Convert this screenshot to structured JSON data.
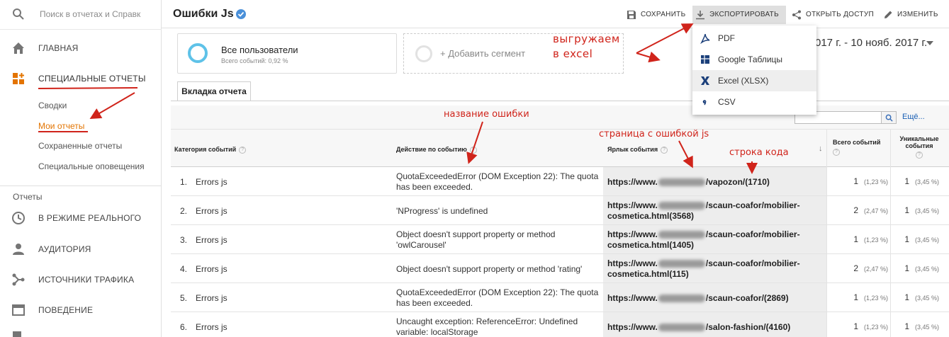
{
  "sidebar": {
    "search_placeholder": "Поиск в отчетах и Справк",
    "home": "ГЛАВНАЯ",
    "custom_reports": "СПЕЦИАЛЬНЫЕ ОТЧЕТЫ",
    "sub": [
      "Сводки",
      "Мои отчеты",
      "Сохраненные отчеты",
      "Специальные оповещения"
    ],
    "reports_section": "Отчеты",
    "items": [
      "В РЕЖИМЕ РЕАЛЬНОГО",
      "АУДИТОРИЯ",
      "ИСТОЧНИКИ ТРАФИКА",
      "ПОВЕДЕНИЕ"
    ]
  },
  "header": {
    "title": "Ошибки Js",
    "save": "СОХРАНИТЬ",
    "export": "ЭКСПОРТИРОВАТЬ",
    "share": "ОТКРЫТЬ ДОСТУП",
    "edit": "ИЗМЕНИТЬ"
  },
  "segments": {
    "all_users": "Все пользователи",
    "all_users_sub": "Всего событий: 0,92 %",
    "add_segment": "+ Добавить сегмент"
  },
  "date_range": "017 г. - 10 нояб. 2017 г.",
  "export_menu": [
    "PDF",
    "Google Таблицы",
    "Excel (XLSX)",
    "CSV"
  ],
  "tab": "Вкладка отчета",
  "more_label": "Ещё...",
  "columns": {
    "category": "Категория событий",
    "action": "Действие по событию",
    "label": "Ярлык события",
    "total": "Всего событий",
    "unique": "Уникальные события"
  },
  "rows": [
    {
      "n": "1.",
      "cat": "Errors js",
      "action": "QuotaExceededError (DOM Exception 22): The quota has been exceeded.",
      "pre": "https://www.",
      "post": "/vapozon/(1710)",
      "total": "1",
      "tpct": "(1,23 %)",
      "uniq": "1",
      "upct": "(3,45 %)"
    },
    {
      "n": "2.",
      "cat": "Errors js",
      "action": "'NProgress' is undefined",
      "pre": "https://www.",
      "post": "/scaun-coafor/mobilier-cosmetica.html(3568)",
      "total": "2",
      "tpct": "(2,47 %)",
      "uniq": "1",
      "upct": "(3,45 %)"
    },
    {
      "n": "3.",
      "cat": "Errors js",
      "action": "Object doesn't support property or method 'owlCarousel'",
      "pre": "https://www.",
      "post": "/scaun-coafor/mobilier-cosmetica.html(1405)",
      "total": "1",
      "tpct": "(1,23 %)",
      "uniq": "1",
      "upct": "(3,45 %)"
    },
    {
      "n": "4.",
      "cat": "Errors js",
      "action": "Object doesn't support property or method 'rating'",
      "pre": "https://www.",
      "post": "/scaun-coafor/mobilier-cosmetica.html(115)",
      "total": "2",
      "tpct": "(2,47 %)",
      "uniq": "1",
      "upct": "(3,45 %)"
    },
    {
      "n": "5.",
      "cat": "Errors js",
      "action": "QuotaExceededError (DOM Exception 22): The quota has been exceeded.",
      "pre": "https://www.",
      "post": "/scaun-coafor/(2869)",
      "total": "1",
      "tpct": "(1,23 %)",
      "uniq": "1",
      "upct": "(3,45 %)"
    },
    {
      "n": "6.",
      "cat": "Errors js",
      "action": "Uncaught exception: ReferenceError: Undefined variable: localStorage",
      "pre": "https://www.",
      "post": "/salon-fashion/(4160)",
      "total": "1",
      "tpct": "(1,23 %)",
      "uniq": "1",
      "upct": "(3,45 %)"
    }
  ],
  "annotations": {
    "excel": "выгружаем\nв excel",
    "error_name": "название ошибки",
    "page": "страница с ошибкой js",
    "code_line": "строка кода"
  },
  "colors": {
    "annotation": "#d0241b",
    "accent_orange": "#e37400",
    "segment_ring": "#5ec2e8",
    "verified": "#4a90d9"
  }
}
